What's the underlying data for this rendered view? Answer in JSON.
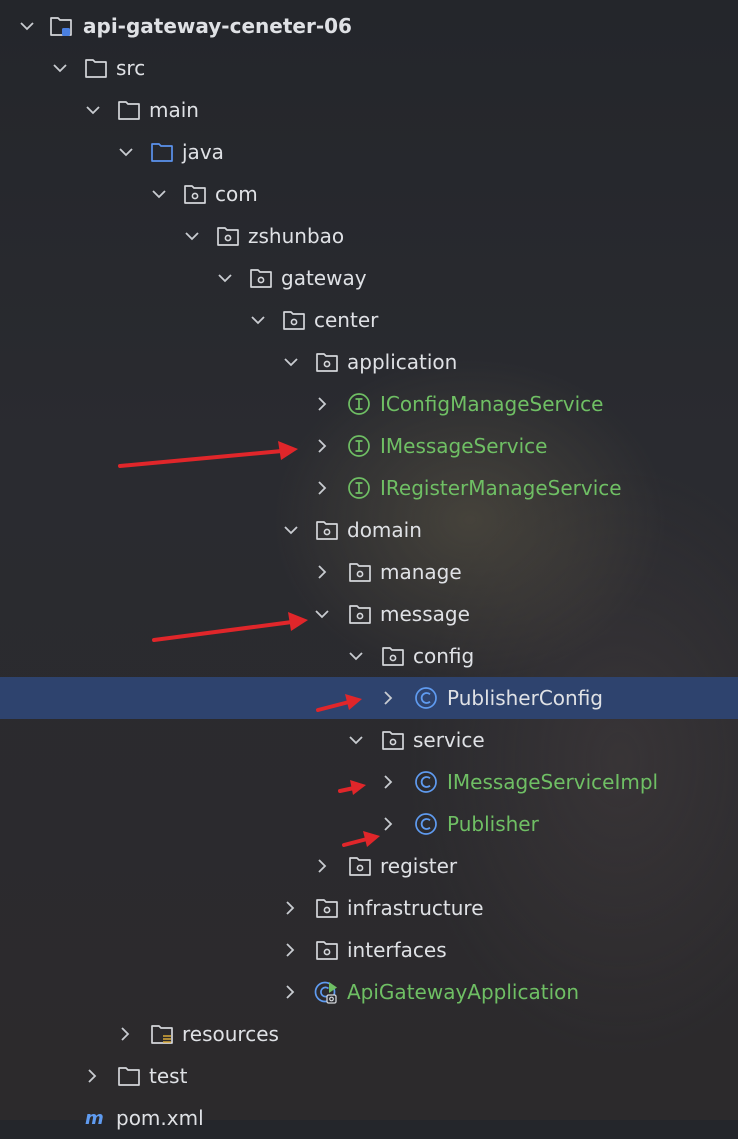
{
  "colors": {
    "selection": "#2e436e",
    "interface_green": "#6fbf64",
    "class_blue": "#5f9bf0",
    "text": "#dfe1e5",
    "arrow_red": "#e0262a"
  },
  "tree": {
    "root": {
      "label": "api-gateway-ceneter-06",
      "icon": "module-folder-icon",
      "state": "expanded"
    },
    "src": {
      "label": "src",
      "icon": "folder-icon",
      "state": "expanded"
    },
    "main": {
      "label": "main",
      "icon": "folder-icon",
      "state": "expanded"
    },
    "java": {
      "label": "java",
      "icon": "source-folder-icon",
      "state": "expanded"
    },
    "com": {
      "label": "com",
      "icon": "package-icon",
      "state": "expanded"
    },
    "zshunbao": {
      "label": "zshunbao",
      "icon": "package-icon",
      "state": "expanded"
    },
    "gateway": {
      "label": "gateway",
      "icon": "package-icon",
      "state": "expanded"
    },
    "center": {
      "label": "center",
      "icon": "package-icon",
      "state": "expanded"
    },
    "application": {
      "label": "application",
      "icon": "package-icon",
      "state": "expanded"
    },
    "iconfigmanageservice": {
      "label": "IConfigManageService",
      "icon": "interface-icon",
      "state": "collapsed"
    },
    "imessageservice": {
      "label": "IMessageService",
      "icon": "interface-icon",
      "state": "collapsed"
    },
    "iregistermanageservice": {
      "label": "IRegisterManageService",
      "icon": "interface-icon",
      "state": "collapsed"
    },
    "domain": {
      "label": "domain",
      "icon": "package-icon",
      "state": "expanded"
    },
    "manage": {
      "label": "manage",
      "icon": "package-icon",
      "state": "collapsed"
    },
    "message": {
      "label": "message",
      "icon": "package-icon",
      "state": "expanded"
    },
    "config": {
      "label": "config",
      "icon": "package-icon",
      "state": "expanded"
    },
    "publisherconfig": {
      "label": "PublisherConfig",
      "icon": "class-icon",
      "state": "collapsed",
      "selected": true
    },
    "service": {
      "label": "service",
      "icon": "package-icon",
      "state": "expanded"
    },
    "imessageserviceimpl": {
      "label": "IMessageServiceImpl",
      "icon": "class-icon",
      "state": "collapsed"
    },
    "publisher": {
      "label": "Publisher",
      "icon": "class-icon",
      "state": "collapsed"
    },
    "register": {
      "label": "register",
      "icon": "package-icon",
      "state": "collapsed"
    },
    "infrastructure": {
      "label": "infrastructure",
      "icon": "package-icon",
      "state": "collapsed"
    },
    "interfaces": {
      "label": "interfaces",
      "icon": "package-icon",
      "state": "collapsed"
    },
    "apigatewayapplication": {
      "label": "ApiGatewayApplication",
      "icon": "spring-boot-app-icon",
      "state": "collapsed"
    },
    "resources": {
      "label": "resources",
      "icon": "resources-folder-icon",
      "state": "collapsed"
    },
    "test": {
      "label": "test",
      "icon": "folder-icon",
      "state": "collapsed"
    },
    "pom": {
      "label": "pom.xml",
      "icon": "maven-icon"
    }
  }
}
